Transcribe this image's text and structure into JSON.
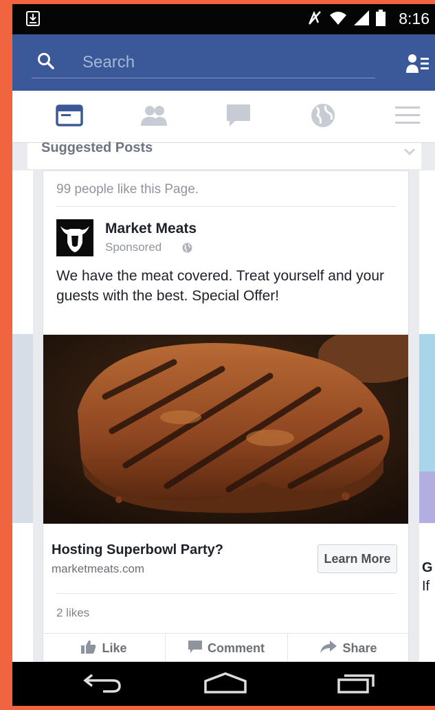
{
  "status_bar": {
    "time": "8:16",
    "icons": [
      "download-icon",
      "mute-icon",
      "wifi-icon",
      "signal-icon",
      "battery-icon"
    ]
  },
  "top_bar": {
    "search_placeholder": "Search",
    "background_color": "#3b5998"
  },
  "nav_tabs": [
    {
      "name": "news-feed",
      "icon": "news-feed-icon",
      "active": true
    },
    {
      "name": "friends",
      "icon": "friends-icon",
      "active": false
    },
    {
      "name": "messages",
      "icon": "chat-bubble-icon",
      "active": false
    },
    {
      "name": "notifications",
      "icon": "globe-icon",
      "active": false
    },
    {
      "name": "more",
      "icon": "menu-icon",
      "active": false
    }
  ],
  "feed": {
    "section_title": "Suggested Posts",
    "card": {
      "page_likes": "99 people like this Page.",
      "page_name": "Market Meats",
      "sponsored": "Sponsored",
      "post_text": "We have the meat covered. Treat yourself and your guests with the best. Special Offer!",
      "ad_title": "Hosting Superbowl Party?",
      "ad_domain": "marketmeats.com",
      "cta_label": "Learn More",
      "like_count": "2 likes",
      "actions": {
        "like": "Like",
        "comment": "Comment",
        "share": "Share"
      }
    },
    "right_peek": {
      "title_fragment": "G",
      "sub_fragment": "If"
    }
  },
  "android_nav": [
    "back-icon",
    "home-icon",
    "recents-icon"
  ]
}
